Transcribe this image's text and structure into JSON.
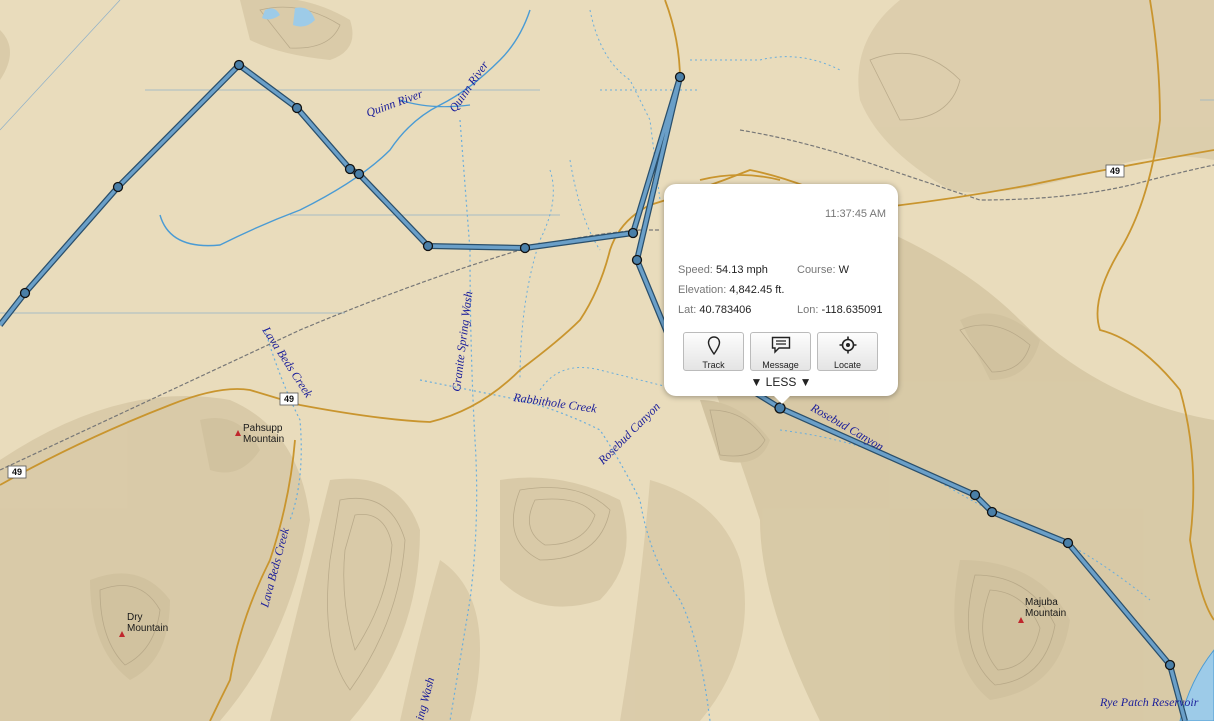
{
  "map": {
    "places": [
      {
        "name": "Pahsupp",
        "name2": "Mountain"
      },
      {
        "name": "Dry",
        "name2": "Mountain"
      },
      {
        "name": "Majuba",
        "name2": "Mountain"
      }
    ],
    "water_labels": [
      "Quinn River",
      "Quinn River",
      "Granite Spring Wash",
      "Lava Beds Creek",
      "Lava Beds Creek",
      "Rabbithole Creek",
      "Rosebud Canyon",
      "Rosebud Canyon",
      "Rye Patch Reservoir",
      "ing Wash"
    ],
    "highways": [
      "49",
      "49",
      "49"
    ]
  },
  "popup": {
    "time": "11:37:45 AM",
    "speed_label": "Speed:",
    "speed": "54.13 mph",
    "course_label": "Course:",
    "course": "W",
    "elevation_label": "Elevation:",
    "elevation": "4,842.45 ft.",
    "lat_label": "Lat:",
    "lat": "40.783406",
    "lon_label": "Lon:",
    "lon": "-118.635091",
    "buttons": {
      "track": "Track",
      "message": "Message",
      "locate": "Locate"
    },
    "less": "▼ LESS ▼"
  },
  "colors": {
    "land": "#e9dcbc",
    "track": "#4a7fa8",
    "water": "#4a9bd4",
    "road": "#c9952e"
  }
}
